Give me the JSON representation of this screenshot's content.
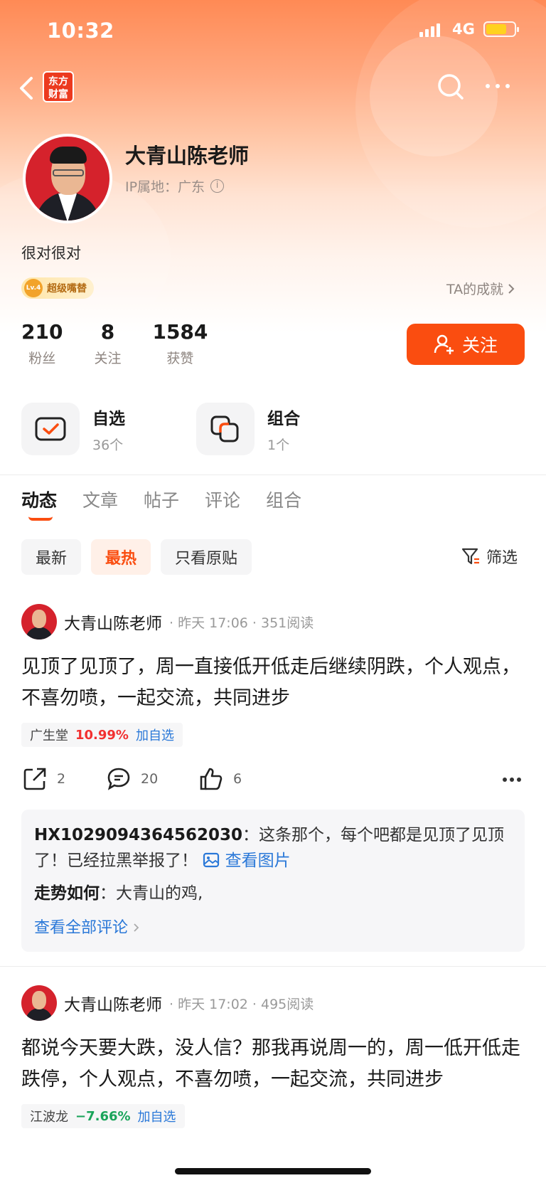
{
  "status_bar": {
    "time": "10:32",
    "network": "4G"
  },
  "nav": {
    "logo_line1": "东方",
    "logo_line2": "财富"
  },
  "profile": {
    "name": "大青山陈老师",
    "ip_label": "IP属地：广东",
    "bio": "很对很对",
    "badge_level": "Lv.4",
    "badge_text": "超级嘴替",
    "achievements": "TA的成就",
    "stats": [
      {
        "num": "210",
        "label": "粉丝"
      },
      {
        "num": "8",
        "label": "关注"
      },
      {
        "num": "1584",
        "label": "获赞"
      }
    ],
    "follow_label": "关注"
  },
  "shortcuts": [
    {
      "title": "自选",
      "sub": "36个"
    },
    {
      "title": "组合",
      "sub": "1个"
    }
  ],
  "tabs": [
    "动态",
    "文章",
    "帖子",
    "评论",
    "组合"
  ],
  "filters": [
    "最新",
    "最热",
    "只看原贴"
  ],
  "filter_button": "筛选",
  "posts": [
    {
      "author": "大青山陈老师",
      "meta": "· 昨天 17:06 · 351阅读",
      "body": "见顶了见顶了，周一直接低开低走后继续阴跌，个人观点，不喜勿喷，一起交流，共同进步",
      "stock_name": "广生堂",
      "stock_pct": "10.99%",
      "stock_add": "加自选",
      "shares": "2",
      "comments": "20",
      "likes": "6"
    },
    {
      "author": "大青山陈老师",
      "meta": "· 昨天 17:02 · 495阅读",
      "body": "都说今天要大跌，没人信？那我再说周一的，周一低开低走跌停，个人观点，不喜勿喷，一起交流，共同进步",
      "stock_name": "江波龙",
      "stock_pct": "−7.66%",
      "stock_add": "加自选"
    }
  ],
  "comment_box": {
    "c1_user": "HX1029094364562030",
    "c1_sep": "：",
    "c1_text": "这条那个，每个吧都是见顶了见顶了！已经拉黑举报了！",
    "c1_link": "查看图片",
    "c2_user": "走势如何",
    "c2_sep": "：",
    "c2_text": "大青山的鸡,",
    "more": "查看全部评论"
  },
  "colors": {
    "accent": "#fa4d10",
    "up": "#f23030",
    "down": "#1aa45a",
    "link": "#2a78d8"
  }
}
